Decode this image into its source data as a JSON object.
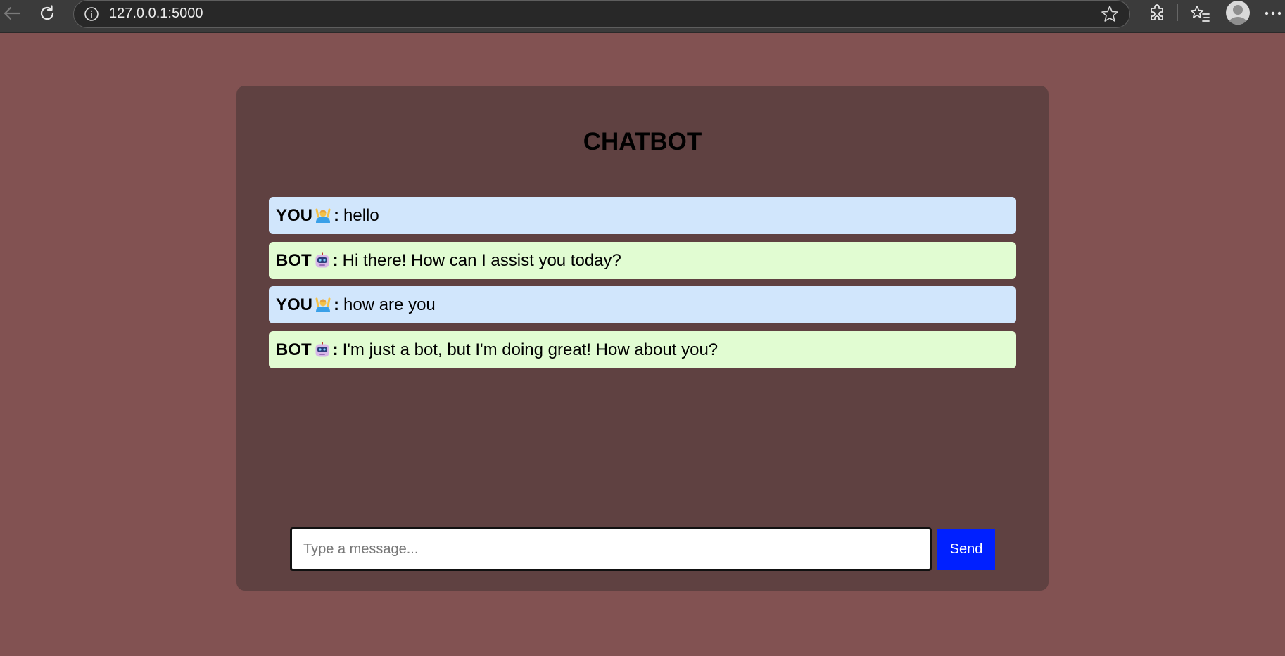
{
  "browser": {
    "url": "127.0.0.1:5000",
    "icons": [
      "back-arrow-icon",
      "reload-icon",
      "site-info-icon",
      "favorite-star-icon",
      "extensions-icon",
      "favorites-icon",
      "profile-avatar-icon",
      "more-options-icon"
    ]
  },
  "chat": {
    "title": "CHATBOT",
    "messages": [
      {
        "sender": "YOU",
        "role": "user",
        "emoji": "person-raising-hands-icon",
        "text": "hello"
      },
      {
        "sender": "BOT",
        "role": "bot",
        "emoji": "robot-face-icon",
        "text": "Hi there! How can I assist you today?"
      },
      {
        "sender": "YOU",
        "role": "user",
        "emoji": "person-raising-hands-icon",
        "text": "how are you"
      },
      {
        "sender": "BOT",
        "role": "bot",
        "emoji": "robot-face-icon",
        "text": "I'm just a bot, but I'm doing great! How about you?"
      }
    ],
    "separator": ":",
    "input_placeholder": "Type a message...",
    "input_value": "",
    "send_label": "Send"
  },
  "colors": {
    "page_background": "#825252",
    "card_background": "#5f4141",
    "user_bubble": "#d1e6fc",
    "bot_bubble": "#e1fcd2",
    "chat_log_border": "#2e9a3e",
    "send_button": "#0020ff"
  }
}
